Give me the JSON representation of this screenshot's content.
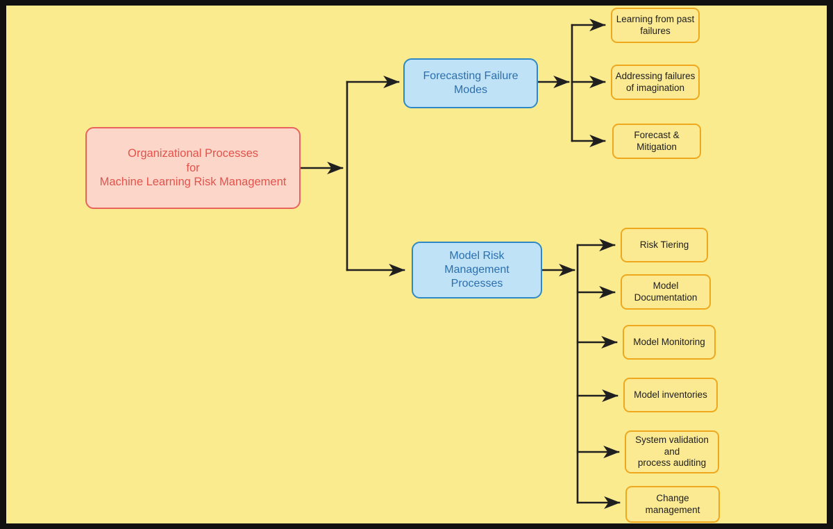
{
  "diagram": {
    "title": "Organizational Processes for Machine Learning Risk Management",
    "type": "tree-flowchart",
    "orientation": "left-to-right",
    "colors": {
      "background": "#fbeb8f",
      "frame": "#111111",
      "root_fill": "#fbd6c9",
      "root_border": "#e7635b",
      "root_text": "#e2534c",
      "branch_fill": "#c0e2f6",
      "branch_border": "#2d88c6",
      "branch_text": "#2a6fae",
      "leaf_fill": "#fcea93",
      "leaf_border": "#efa81d",
      "leaf_text": "#1c1c1c",
      "edge": "#1f1f1f"
    },
    "root": {
      "id": "root",
      "label": "Organizational Processes\nfor\nMachine Learning Risk Management"
    },
    "branches": [
      {
        "id": "forecasting-failure-modes",
        "label": "Forecasting Failure\nModes",
        "children": [
          {
            "id": "learning-from-past-failures",
            "label": "Learning from past\nfailures"
          },
          {
            "id": "addressing-failures-of-imagination",
            "label": "Addressing failures\nof imagination"
          },
          {
            "id": "forecast-and-mitigation",
            "label": "Forecast &\nMitigation"
          }
        ]
      },
      {
        "id": "model-risk-management-processes",
        "label": "Model Risk\nManagement\nProcesses",
        "children": [
          {
            "id": "risk-tiering",
            "label": "Risk Tiering"
          },
          {
            "id": "model-documentation",
            "label": "Model\nDocumentation"
          },
          {
            "id": "model-monitoring",
            "label": "Model Monitoring"
          },
          {
            "id": "model-inventories",
            "label": "Model inventories"
          },
          {
            "id": "system-validation-and-process-auditing",
            "label": "System validation\nand\nprocess auditing"
          },
          {
            "id": "change-management",
            "label": "Change\nmanagement"
          }
        ]
      }
    ]
  }
}
